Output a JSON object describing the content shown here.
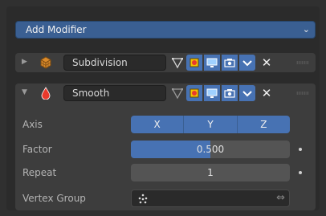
{
  "add_modifier": {
    "label": "Add Modifier",
    "icon": "chevron-down-icon"
  },
  "modifiers": [
    {
      "name": "Subdivision",
      "expanded": false,
      "icon": "subdivision-modifier-icon",
      "header_buttons": [
        "edit-mode-icon",
        "on-cage-icon",
        "viewport-icon",
        "render-icon",
        "dropdown-icon",
        "close-icon"
      ]
    },
    {
      "name": "Smooth",
      "expanded": true,
      "icon": "smooth-modifier-icon",
      "header_buttons": [
        "edit-mode-icon",
        "on-cage-icon",
        "viewport-icon",
        "render-icon",
        "dropdown-icon",
        "close-icon"
      ],
      "properties": {
        "axis": {
          "label": "Axis",
          "options": [
            "X",
            "Y",
            "Z"
          ],
          "selected": [
            "X",
            "Y",
            "Z"
          ]
        },
        "factor": {
          "label": "Factor",
          "value": "0.500",
          "fill_fraction": 0.5
        },
        "repeat": {
          "label": "Repeat",
          "value": "1"
        },
        "vertex_group": {
          "label": "Vertex Group",
          "value": ""
        }
      }
    }
  ],
  "colors": {
    "accent": "#4772b3",
    "panel": "#3d3d3d",
    "background": "#303030",
    "smooth_icon": "#e8392c",
    "subdivision_icon": "#d98a2b"
  }
}
